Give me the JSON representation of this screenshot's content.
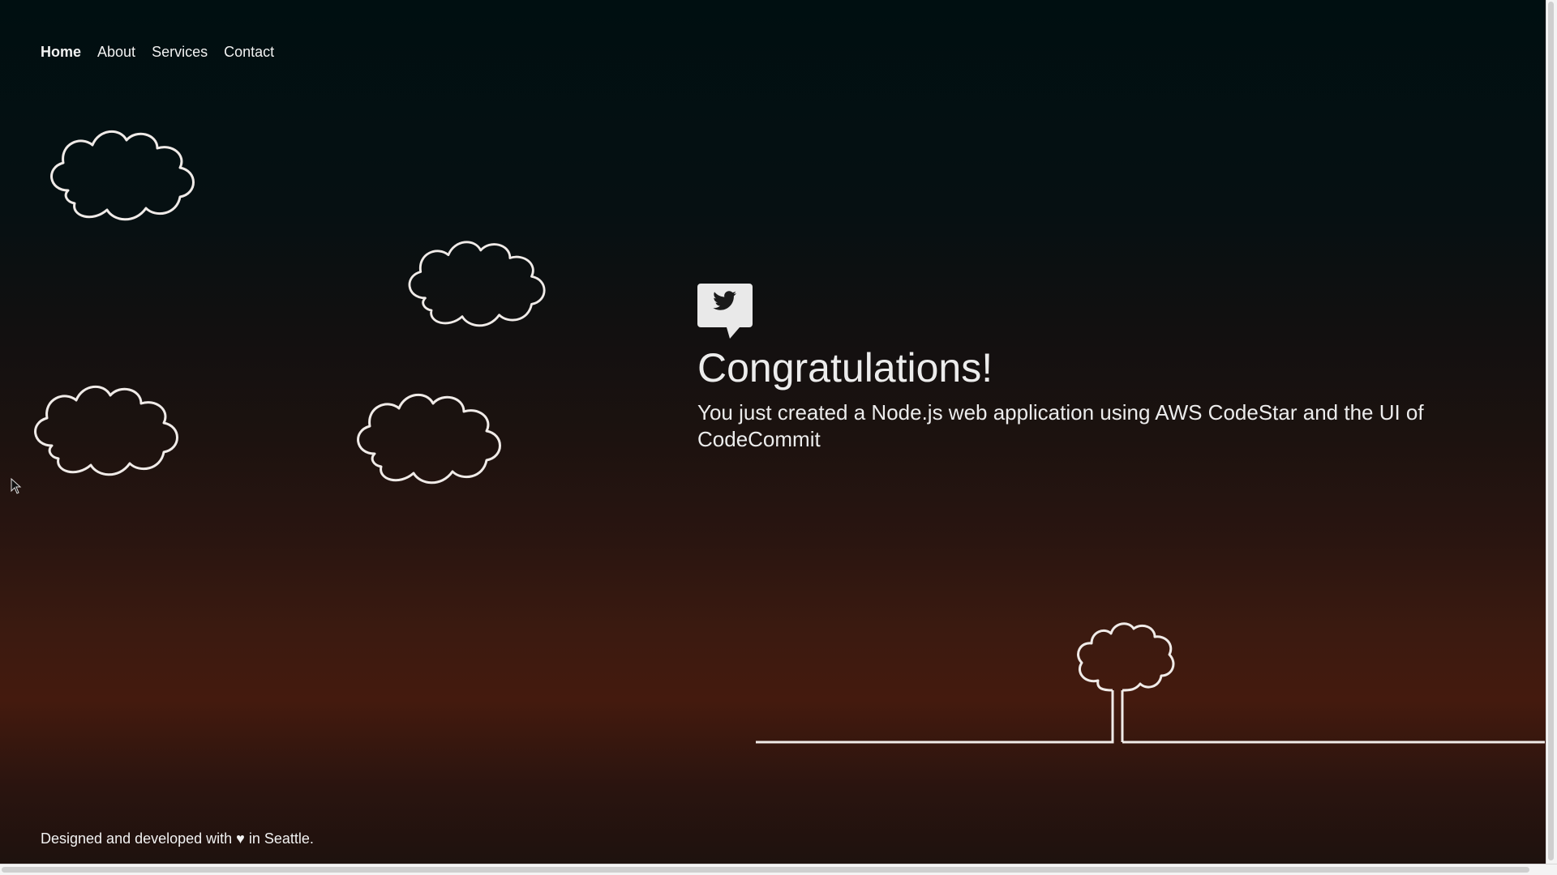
{
  "nav": {
    "items": [
      {
        "label": "Home",
        "active": true
      },
      {
        "label": "About",
        "active": false
      },
      {
        "label": "Services",
        "active": false
      },
      {
        "label": "Contact",
        "active": false
      }
    ]
  },
  "hero": {
    "icon": "twitter-bird-icon",
    "title": "Congratulations!",
    "message": "You just created a Node.js web application using AWS CodeStar and the UI of CodeCommit"
  },
  "footer": {
    "text": "Designed and developed with ♥ in Seattle."
  },
  "colors": {
    "line": "#f0ebe8",
    "text": "#ececec",
    "bg_top": "#000f11",
    "bg_bottom_glow": "#441a0e"
  }
}
